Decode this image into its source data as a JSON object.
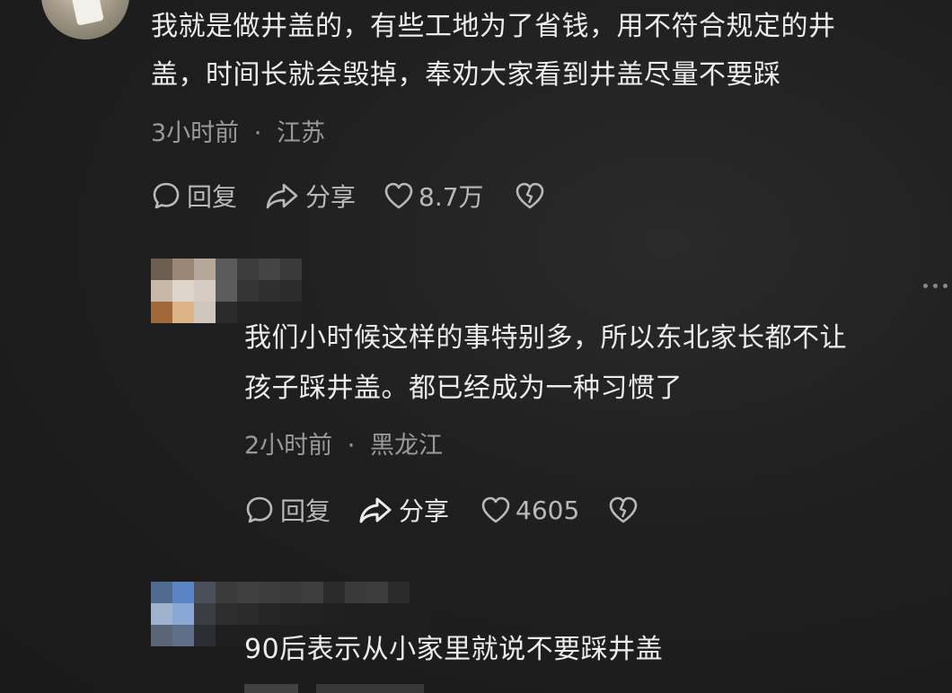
{
  "comments": [
    {
      "text_line1": "我就是做井盖的，有些工地为了省钱，用不符合规定的井",
      "text_line2": "盖，时间长就会毁掉，奉劝大家看到井盖尽量不要踩",
      "time": "3小时前",
      "region": "江苏",
      "reply_label": "回复",
      "share_label": "分享",
      "likes": "8.7万"
    },
    {
      "text_line1": "我们小时候这样的事特别多，所以东北家长都不让",
      "text_line2": "孩子踩井盖。都已经成为一种习惯了",
      "time": "2小时前",
      "region": "黑龙江",
      "reply_label": "回复",
      "share_label": "分享",
      "likes": "4605"
    },
    {
      "text_line1": "90后表示从小家里就说不要踩井盖"
    }
  ],
  "separator": "·",
  "icons": {
    "reply": "comment-bubble-icon",
    "share": "share-arrow-icon",
    "like": "heart-icon",
    "dislike": "broken-heart-icon",
    "more": "more-dots-icon"
  },
  "colors": {
    "background": "#1d1d1d",
    "text": "#ececec",
    "meta": "#9a9a9a",
    "action": "#b9b9b9"
  }
}
